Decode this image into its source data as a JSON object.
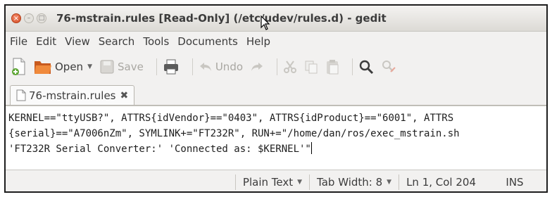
{
  "window": {
    "title": "76-mstrain.rules [Read-Only] (/etc/udev/rules.d) - gedit",
    "close_glyph": "×",
    "min_glyph": "–",
    "max_glyph": "□"
  },
  "menu": [
    "File",
    "Edit",
    "View",
    "Search",
    "Tools",
    "Documents",
    "Help"
  ],
  "toolbar": {
    "new_icon": "new-document-icon",
    "open_label": "Open",
    "save_label": "Save",
    "print_icon": "printer-icon",
    "undo_label": "Undo",
    "redo_icon": "redo-icon",
    "cut_icon": "scissors-icon",
    "copy_icon": "copy-icon",
    "paste_icon": "paste-icon",
    "find_icon": "search-icon",
    "replace_icon": "find-replace-icon"
  },
  "tab": {
    "label": "76-mstrain.rules",
    "close_glyph": "✖"
  },
  "editor": {
    "lines": [
      "KERNEL==\"ttyUSB?\", ATTRS{idVendor}==\"0403\", ATTRS{idProduct}==\"6001\", ATTRS",
      "{serial}==\"A7006nZm\", SYMLINK+=\"FT232R\", RUN+=\"/home/dan/ros/exec_mstrain.sh",
      "'FT232R Serial Converter:' 'Connected as: $KERNEL'\""
    ]
  },
  "status": {
    "language": "Plain Text",
    "tab_width": "Tab Width: 8",
    "position": "Ln 1, Col 204",
    "mode": "INS"
  },
  "colors": {
    "accent_close": "#d24b22",
    "open_folder": "#e8742c"
  }
}
